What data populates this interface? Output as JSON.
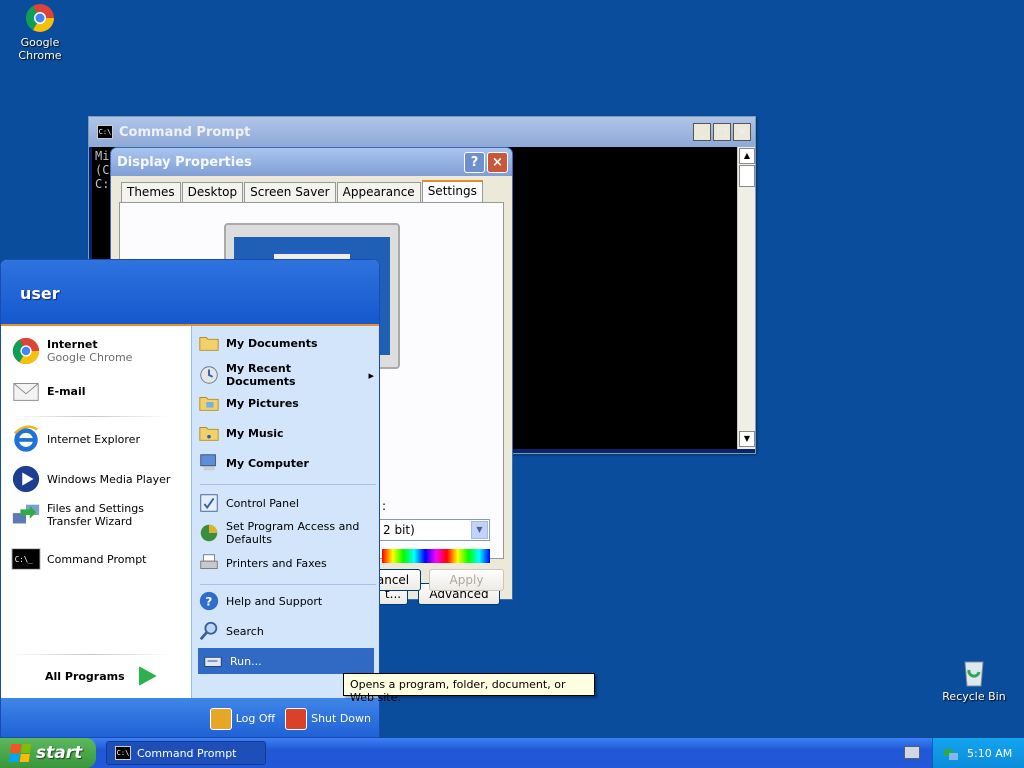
{
  "desktop": {
    "chrome_label": "Google Chrome",
    "recycle_label": "Recycle Bin",
    "background": "#0a4d9c"
  },
  "cmd_window": {
    "title": "Command Prompt",
    "icon_text": "C:\\",
    "buttons": {
      "minimize": "_",
      "maximize": "□",
      "close": "×"
    },
    "lines": [
      "Mi",
      "(C",
      "",
      "C:"
    ]
  },
  "display_properties": {
    "title": "Display Properties",
    "help": "?",
    "close": "×",
    "tabs": [
      "Themes",
      "Desktop",
      "Screen Saver",
      "Appearance",
      "Settings"
    ],
    "active_tab": "Settings",
    "color_quality_value": "2 bit)",
    "colon_fragment": ":",
    "troubleshoot_fragment": "t...",
    "advanced": "Advanced",
    "cancel_fragment": "ancel",
    "apply": "Apply"
  },
  "start_menu": {
    "user": "user",
    "pinned": [
      {
        "title": "Internet",
        "subtitle": "Google Chrome"
      },
      {
        "title": "E-mail"
      }
    ],
    "recent": [
      {
        "label": "Internet Explorer"
      },
      {
        "label": "Windows Media Player"
      },
      {
        "label": "Files and Settings Transfer Wizard"
      },
      {
        "label": "Command Prompt"
      }
    ],
    "all_programs": "All Programs",
    "right_top": [
      {
        "label": "My Documents"
      },
      {
        "label": "My Recent Documents",
        "arrow": "▸"
      },
      {
        "label": "My Pictures"
      },
      {
        "label": "My Music"
      },
      {
        "label": "My Computer"
      }
    ],
    "right_mid": [
      {
        "label": "Control Panel"
      },
      {
        "label": "Set Program Access and Defaults"
      },
      {
        "label": "Printers and Faxes"
      }
    ],
    "right_bottom": [
      {
        "label": "Help and Support"
      },
      {
        "label": "Search"
      },
      {
        "label": "Run..."
      }
    ],
    "log_off": "Log Off",
    "shut_down": "Shut Down"
  },
  "tooltip": "Opens a program, folder, document, or Web site.",
  "taskbar": {
    "start": "start",
    "task_cmd": "Command Prompt",
    "clock": "5:10 AM"
  }
}
